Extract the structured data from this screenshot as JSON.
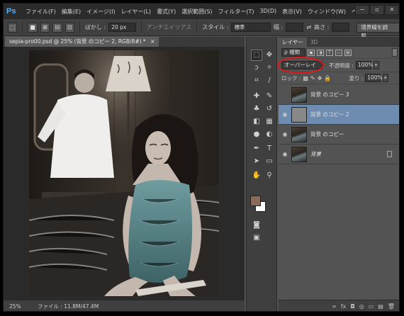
{
  "app": {
    "logo": "Ps"
  },
  "menu": [
    "ファイル(F)",
    "編集(E)",
    "イメージ(I)",
    "レイヤー(L)",
    "書式(Y)",
    "選択範囲(S)",
    "フィルター(T)",
    "3D(D)",
    "表示(V)",
    "ウィンドウ(W)",
    "ヘルプ"
  ],
  "window_controls": {
    "minimize": "−",
    "restore": "▫",
    "close": "✕"
  },
  "options": {
    "feather_label": "ぼかし :",
    "feather_value": "20 px",
    "antialias_label": "アンチエイリアス",
    "style_label": "スタイル :",
    "style_value": "標準",
    "width_label": "幅 :",
    "height_label": "高さ :",
    "refine_edge": "境界線を調整..."
  },
  "document": {
    "tab_title": "sepia-pro00.psd @ 25% (背景 のコピー 2, RGB/8#) *",
    "close": "×"
  },
  "status": {
    "zoom": "25%",
    "info": "ファイル : 11.8M/47.4M"
  },
  "tools": [
    "marquee-icon",
    "move-icon",
    "lasso-icon",
    "magic-wand-icon",
    "crop-icon",
    "eyedropper-icon",
    "healing-icon",
    "brush-icon",
    "stamp-icon",
    "history-brush-icon",
    "eraser-icon",
    "gradient-icon",
    "blur-icon",
    "dodge-icon",
    "pen-icon",
    "type-icon",
    "path-select-icon",
    "shape-icon",
    "hand-icon",
    "zoom-icon"
  ],
  "colors": {
    "foreground": "#8b6a5a",
    "background": "#ffffff",
    "selected_layer": "#6e8bb0",
    "highlight_circle": "#e21818"
  },
  "layers_panel": {
    "tabs": [
      "レイヤー",
      "3D"
    ],
    "filter_kind": "ρ 種類",
    "blend_mode": "オーバーレイ",
    "opacity_label": "不透明度 :",
    "opacity_value": "100%",
    "lock_label": "ロック :",
    "fill_label": "塗り :",
    "fill_value": "100%",
    "layers": [
      {
        "name": "背景 のコピー 3",
        "visible": false,
        "selected": false,
        "thumb": "photo",
        "italic": false,
        "locked": false
      },
      {
        "name": "背景 のコピー 2",
        "visible": true,
        "selected": true,
        "thumb": "gray",
        "italic": false,
        "locked": false
      },
      {
        "name": "背景 のコピー",
        "visible": true,
        "selected": false,
        "thumb": "photo",
        "italic": false,
        "locked": false
      },
      {
        "name": "背景",
        "visible": true,
        "selected": false,
        "thumb": "photo",
        "italic": true,
        "locked": true
      }
    ],
    "footer": [
      "∞",
      "fx",
      "◘",
      "◎",
      "▭",
      "▤",
      "🗑"
    ]
  }
}
